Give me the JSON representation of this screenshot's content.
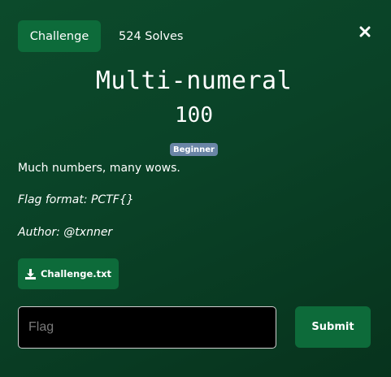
{
  "tabs": {
    "challenge": "Challenge",
    "solves": "524 Solves"
  },
  "close_icon": "close-icon",
  "challenge": {
    "name": "Multi-numeral",
    "points": "100",
    "category_badge": "Beginner",
    "description": "Much numbers, many wows.",
    "flag_format": "Flag format: PCTF{}",
    "author": "Author: @txnner"
  },
  "download": {
    "icon": "download-icon",
    "label": "Challenge.txt"
  },
  "flag_input": {
    "placeholder": "Flag",
    "value": ""
  },
  "submit_label": "Submit",
  "colors": {
    "background": "#0a4227",
    "button": "#0d6b3a",
    "badge": "#6a85a6",
    "input_bg": "#000000"
  }
}
